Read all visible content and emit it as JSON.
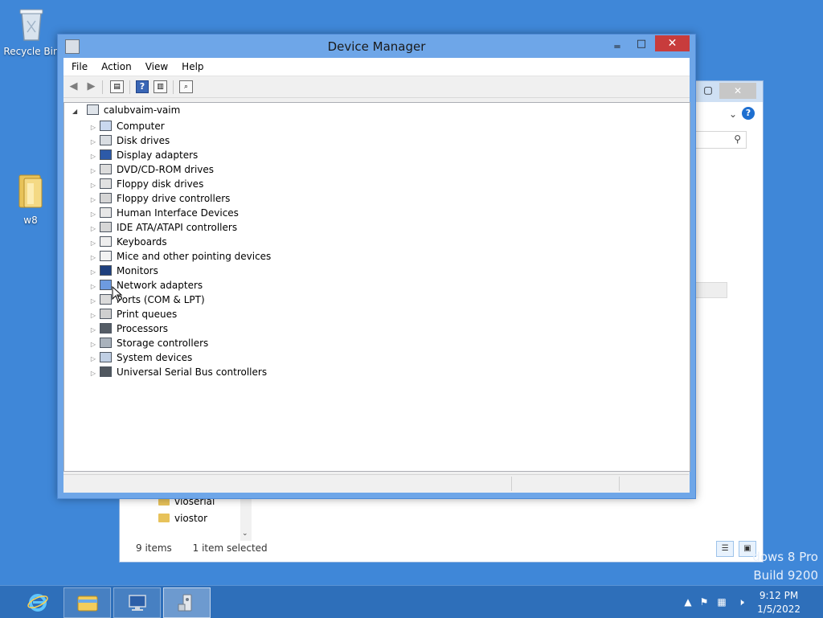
{
  "desktop": {
    "recycle_bin_label": "Recycle Bin",
    "folder_label": "w8",
    "watermark_line1": "dows 8 Pro",
    "watermark_line2": "Build 9200"
  },
  "explorer": {
    "tree_items": [
      "vioserial",
      "viostor"
    ],
    "status_items_count": "9 items",
    "status_selected": "1 item selected"
  },
  "device_manager": {
    "title": "Device Manager",
    "menu": [
      "File",
      "Action",
      "View",
      "Help"
    ],
    "root": "calubvaim-vaim",
    "categories": [
      {
        "label": "Computer",
        "icon": "computer-icon"
      },
      {
        "label": "Disk drives",
        "icon": "disk-drive-icon"
      },
      {
        "label": "Display adapters",
        "icon": "display-adapter-icon"
      },
      {
        "label": "DVD/CD-ROM drives",
        "icon": "dvd-drive-icon"
      },
      {
        "label": "Floppy disk drives",
        "icon": "floppy-disk-icon"
      },
      {
        "label": "Floppy drive controllers",
        "icon": "floppy-controller-icon"
      },
      {
        "label": "Human Interface Devices",
        "icon": "hid-icon"
      },
      {
        "label": "IDE ATA/ATAPI controllers",
        "icon": "ide-controller-icon"
      },
      {
        "label": "Keyboards",
        "icon": "keyboard-icon"
      },
      {
        "label": "Mice and other pointing devices",
        "icon": "mouse-icon"
      },
      {
        "label": "Monitors",
        "icon": "monitor-icon"
      },
      {
        "label": "Network adapters",
        "icon": "network-adapter-icon"
      },
      {
        "label": "Ports (COM & LPT)",
        "icon": "port-icon"
      },
      {
        "label": "Print queues",
        "icon": "printer-icon"
      },
      {
        "label": "Processors",
        "icon": "processor-icon"
      },
      {
        "label": "Storage controllers",
        "icon": "storage-controller-icon"
      },
      {
        "label": "System devices",
        "icon": "system-device-icon"
      },
      {
        "label": "Universal Serial Bus controllers",
        "icon": "usb-icon"
      }
    ]
  },
  "taskbar": {
    "time": "9:12 PM",
    "date": "1/5/2022"
  },
  "colors": {
    "desktop": "#3f87d8",
    "window_frame": "#6ea6e8",
    "close_button": "#c83c3c",
    "taskbar": "#2e6fba"
  }
}
